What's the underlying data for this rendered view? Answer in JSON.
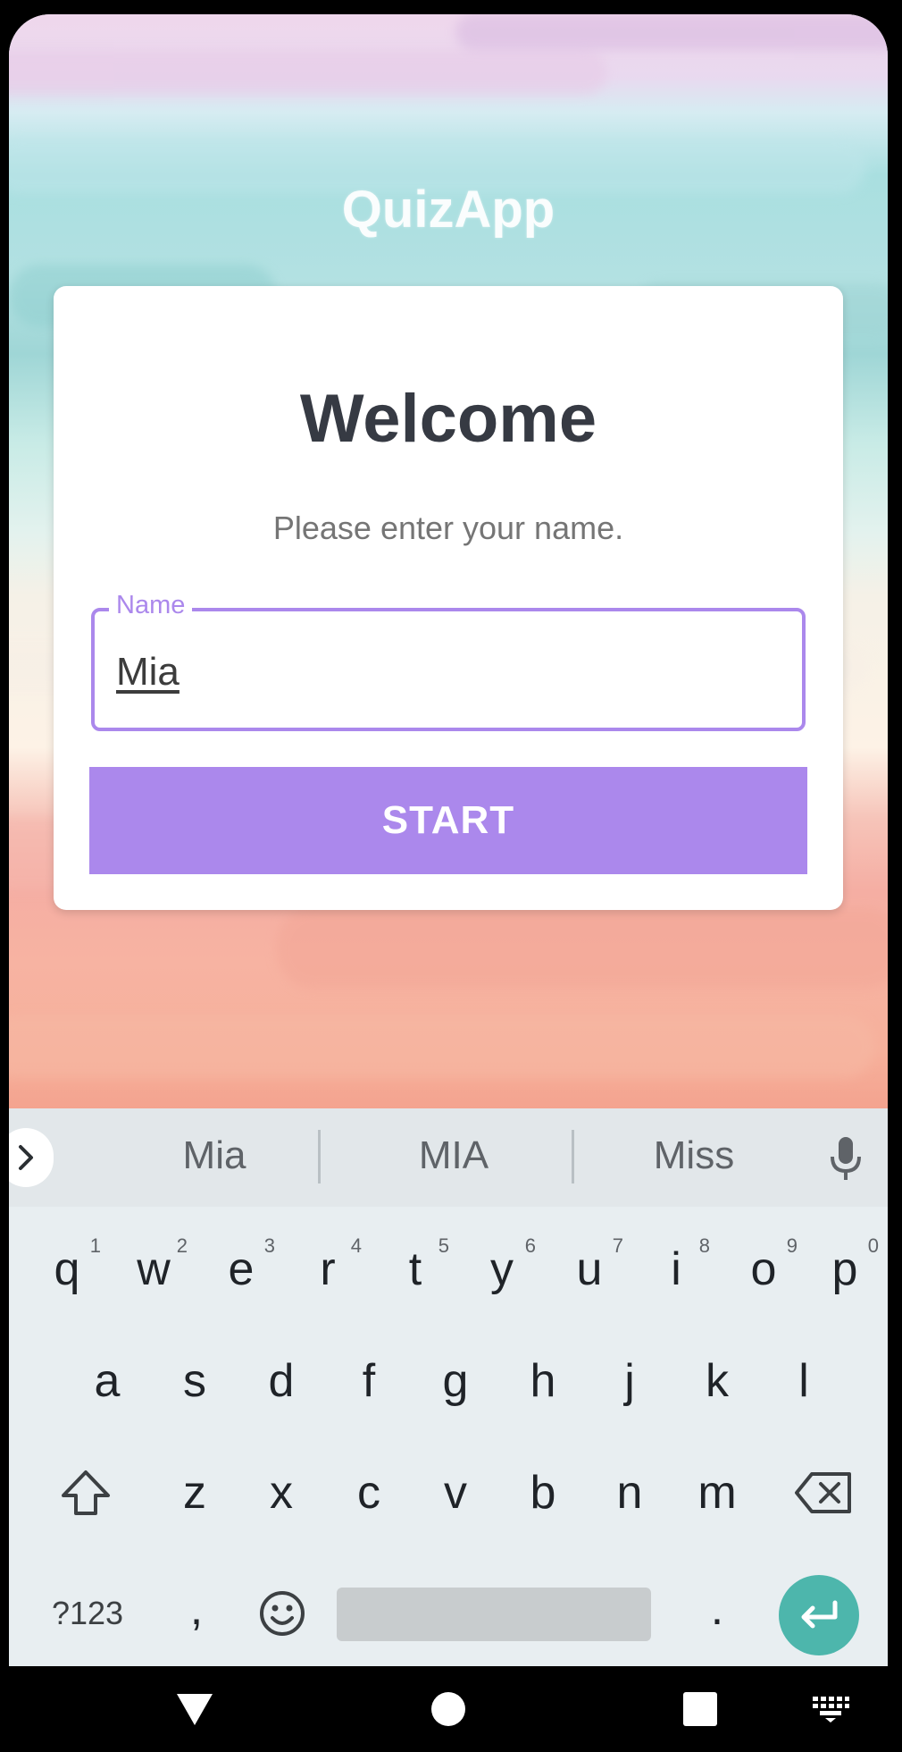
{
  "app": {
    "title": "QuizApp"
  },
  "card": {
    "heading": "Welcome",
    "subtitle": "Please enter your name.",
    "name_field": {
      "label": "Name",
      "value": "Mia"
    },
    "start_label": "START"
  },
  "colors": {
    "accent": "#ab88ec",
    "enter_key": "#4db6ac",
    "heading_text": "#363a43"
  },
  "keyboard": {
    "suggestions": [
      "Mia",
      "MIA",
      "Miss"
    ],
    "row1": [
      {
        "key": "q",
        "hint": "1"
      },
      {
        "key": "w",
        "hint": "2"
      },
      {
        "key": "e",
        "hint": "3"
      },
      {
        "key": "r",
        "hint": "4"
      },
      {
        "key": "t",
        "hint": "5"
      },
      {
        "key": "y",
        "hint": "6"
      },
      {
        "key": "u",
        "hint": "7"
      },
      {
        "key": "i",
        "hint": "8"
      },
      {
        "key": "o",
        "hint": "9"
      },
      {
        "key": "p",
        "hint": "0"
      }
    ],
    "row2": [
      "a",
      "s",
      "d",
      "f",
      "g",
      "h",
      "j",
      "k",
      "l"
    ],
    "row3": [
      "z",
      "x",
      "c",
      "v",
      "b",
      "n",
      "m"
    ],
    "symbols_label": "?123",
    "comma": ",",
    "period": ".",
    "icons": [
      "chevron-right-icon",
      "microphone-icon",
      "shift-icon",
      "backspace-icon",
      "emoji-icon",
      "enter-icon"
    ]
  },
  "navbar": {
    "icons": [
      "back-icon",
      "home-icon",
      "recents-icon",
      "keyboard-icon"
    ]
  }
}
